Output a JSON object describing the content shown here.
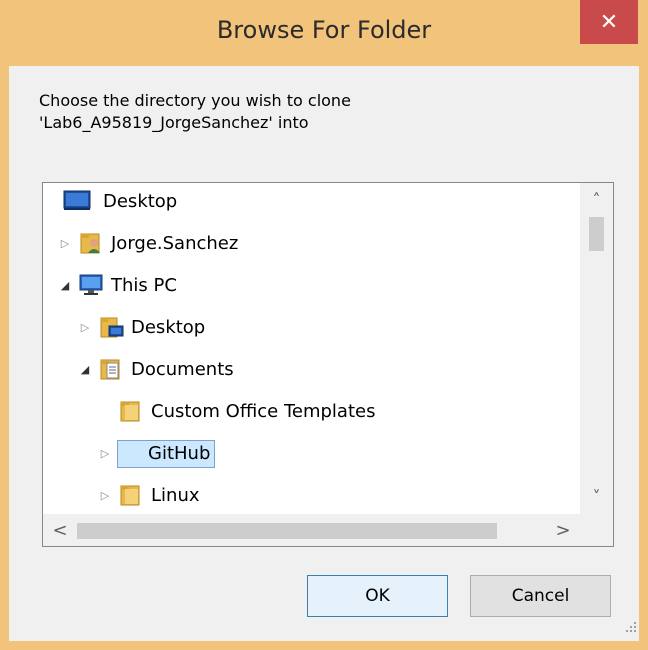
{
  "dialog": {
    "title": "Browse For Folder",
    "close_glyph": "✕",
    "prompt_line1": "Choose the directory you wish to clone",
    "prompt_line2": "'Lab6_A95819_JorgeSanchez' into"
  },
  "tree": {
    "items": [
      {
        "label": "Desktop",
        "icon": "desktop-icon",
        "expander": "none",
        "selected": false
      },
      {
        "label": "Jorge.Sanchez",
        "icon": "user-folder-icon",
        "expander": "collapsed",
        "selected": false
      },
      {
        "label": "This PC",
        "icon": "computer-icon",
        "expander": "expanded",
        "selected": false
      },
      {
        "label": "Desktop",
        "icon": "desktop-folder-icon",
        "expander": "collapsed",
        "selected": false
      },
      {
        "label": "Documents",
        "icon": "documents-folder-icon",
        "expander": "expanded",
        "selected": false
      },
      {
        "label": "Custom Office Templates",
        "icon": "folder-icon",
        "expander": "none",
        "selected": false
      },
      {
        "label": "GitHub",
        "icon": "folder-icon",
        "expander": "collapsed",
        "selected": true
      },
      {
        "label": "Linux",
        "icon": "folder-icon",
        "expander": "collapsed",
        "selected": false
      }
    ]
  },
  "scrollbars": {
    "up": "˄",
    "down": "˅",
    "left": "<",
    "right": ">"
  },
  "buttons": {
    "ok": "OK",
    "cancel": "Cancel"
  },
  "colors": {
    "frame": "#f2c37a",
    "close": "#c94a4a",
    "selection": "#cce8ff"
  }
}
